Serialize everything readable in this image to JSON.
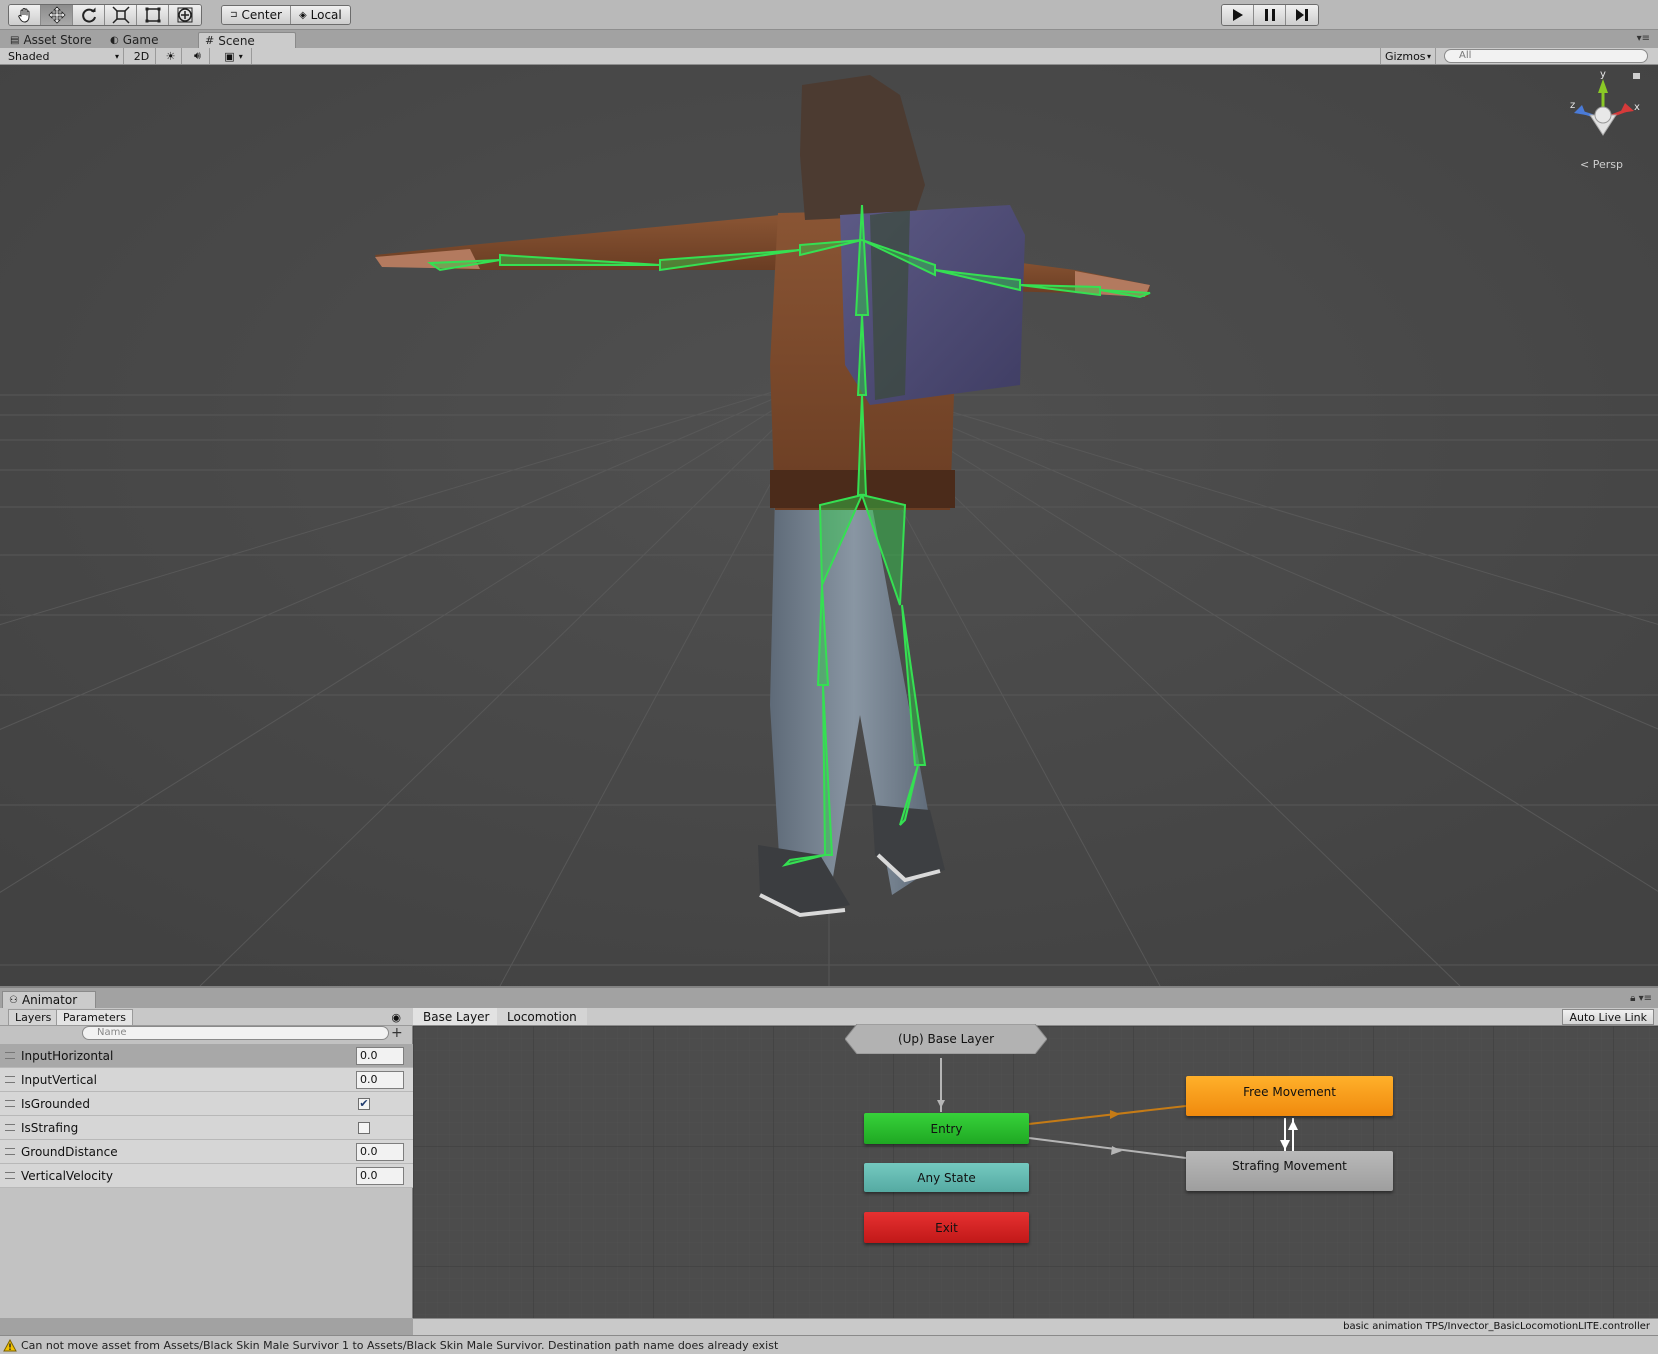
{
  "toolbar": {
    "tools": [
      {
        "name": "hand-tool",
        "icon": "hand-icon",
        "active": false
      },
      {
        "name": "move-tool",
        "icon": "move-arrows-icon",
        "active": true
      },
      {
        "name": "rotate-tool",
        "icon": "rotate-icon",
        "active": false
      },
      {
        "name": "scale-tool",
        "icon": "scale-icon",
        "active": false
      },
      {
        "name": "rect-tool",
        "icon": "rect-transform-icon",
        "active": false
      },
      {
        "name": "transform-tool",
        "icon": "transform-all-icon",
        "active": false
      }
    ],
    "pivot_label": "Center",
    "rotation_label": "Local",
    "play_icon": "play-icon",
    "pause_icon": "pause-icon",
    "step_icon": "step-icon"
  },
  "tabs": [
    {
      "label": "Asset Store",
      "icon": "asset-store-icon",
      "active": false
    },
    {
      "label": "Game",
      "icon": "game-icon",
      "active": false
    },
    {
      "label": "Scene",
      "icon": "scene-grid-icon",
      "active": true
    }
  ],
  "scene_bar": {
    "shading_mode": "Shaded",
    "mode_2d": "2D",
    "gizmos_label": "Gizmos",
    "search_placeholder": "All"
  },
  "scene_view": {
    "projection_label": "Persp",
    "axis_labels": {
      "y": "y",
      "x": "x",
      "z": "z"
    },
    "colors": {
      "background": "#474747",
      "bones": "#2fd14a",
      "axis_y": "#8ac926",
      "axis_x": "#d63a3a",
      "axis_z": "#4a7bd8"
    }
  },
  "animator": {
    "window_title": "Animator",
    "tabs": {
      "layers": "Layers",
      "parameters": "Parameters"
    },
    "search_placeholder": "Name",
    "add_label": "+",
    "parameters": [
      {
        "name": "InputHorizontal",
        "type": "float",
        "value": "0.0",
        "selected": true
      },
      {
        "name": "InputVertical",
        "type": "float",
        "value": "0.0",
        "selected": false
      },
      {
        "name": "IsGrounded",
        "type": "bool",
        "value": true,
        "selected": false
      },
      {
        "name": "IsStrafing",
        "type": "bool",
        "value": false,
        "selected": false
      },
      {
        "name": "GroundDistance",
        "type": "float",
        "value": "0.0",
        "selected": false
      },
      {
        "name": "VerticalVelocity",
        "type": "float",
        "value": "0.0",
        "selected": false
      }
    ],
    "breadcrumbs": [
      "Base Layer",
      "Locomotion"
    ],
    "auto_live_link": "Auto Live Link",
    "states": {
      "up_base": "(Up) Base Layer",
      "entry": "Entry",
      "any_state": "Any State",
      "exit": "Exit",
      "free_movement": "Free Movement",
      "strafing_movement": "Strafing Movement"
    },
    "state_colors": {
      "entry": "#2bc02e",
      "any_state": "#62b8b0",
      "exit": "#d62424",
      "free_movement": "#f59a1a",
      "strafing_movement": "#aeaeae"
    },
    "controller_path": "basic animation TPS/Invector_BasicLocomotionLITE.controller"
  },
  "status": {
    "icon": "warning-icon",
    "message": "Can not move asset from Assets/Black Skin Male Survivor 1 to Assets/Black Skin Male Survivor. Destination path name does already exist"
  }
}
